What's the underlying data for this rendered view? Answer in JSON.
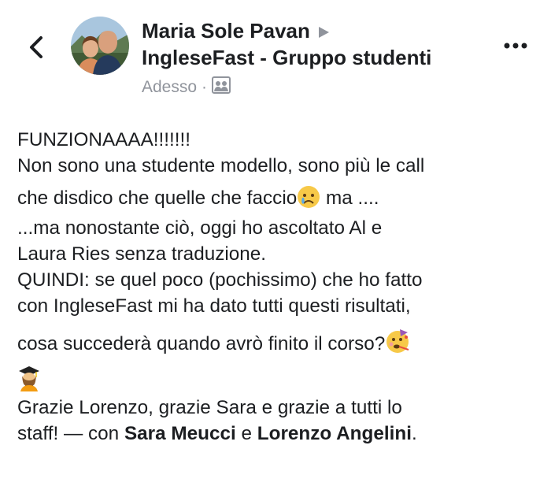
{
  "header": {
    "author": "Maria Sole Pavan",
    "group": "IngleseFast - Gruppo studenti",
    "timestamp": "Adesso",
    "separator": "·",
    "privacy_icon": "group-audience-icon",
    "back_icon": "chevron-left-icon",
    "more_icon": "more-horizontal-icon"
  },
  "post": {
    "line1": "FUNZIONAAAA!!!!!!!",
    "line2": "Non sono una studente modello, sono più le call",
    "line3_before": "che disdico che quelle che faccio",
    "line3_after": " ma ....",
    "line4": "...ma nonostante ciò, oggi ho ascoltato Al e",
    "line5": "Laura Ries senza traduzione.",
    "line6": "QUINDI:  se quel poco (pochissimo) che ho fatto",
    "line7": "con IngleseFast mi ha dato tutti questi risultati,",
    "line8": "cosa succederà quando avrò finito il corso?",
    "line9": "Grazie Lorenzo, grazie Sara e grazie a tutti lo",
    "line10_prefix": "staff! — con ",
    "tag1": "Sara Meucci",
    "line10_mid": " e ",
    "tag2": "Lorenzo Angelini",
    "line10_suffix": ".",
    "emojis": [
      "sad-tear-emoji",
      "party-face-emoji",
      "woman-graduate-emoji"
    ]
  }
}
